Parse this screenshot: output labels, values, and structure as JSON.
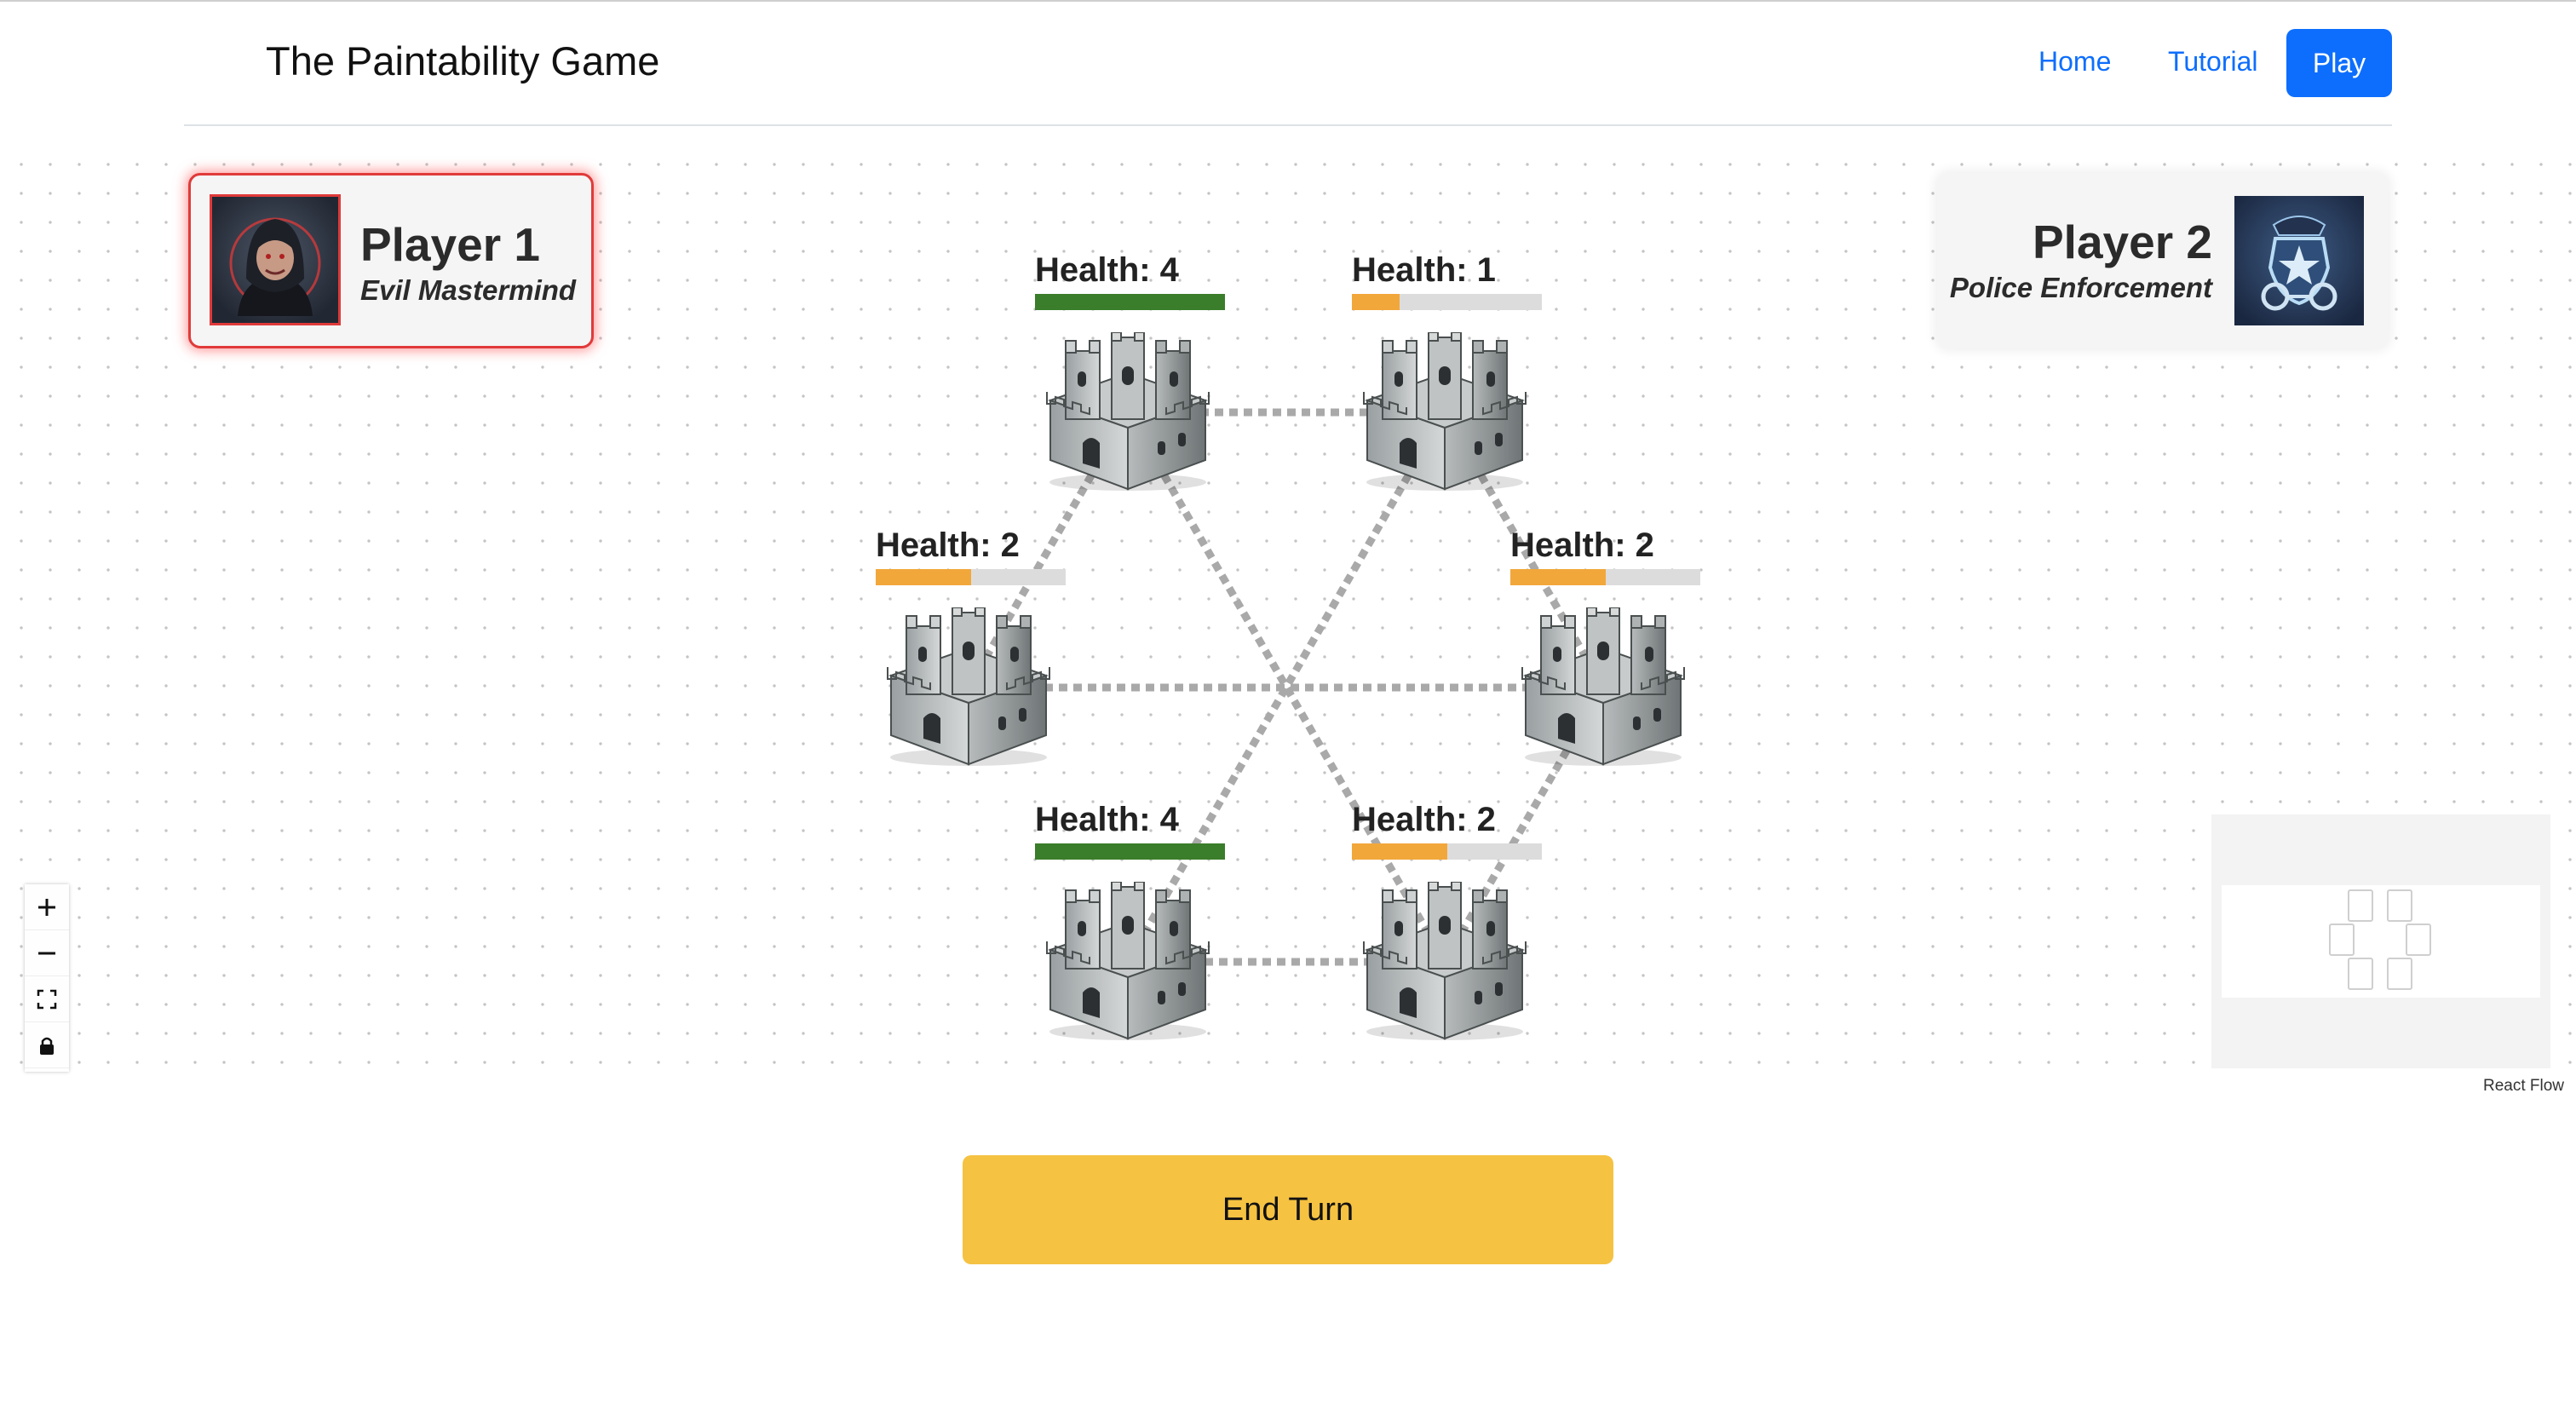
{
  "header": {
    "title": "The Paintability Game",
    "nav": {
      "home": "Home",
      "tutorial": "Tutorial",
      "play": "Play"
    }
  },
  "players": [
    {
      "name": "Player 1",
      "role": "Evil Mastermind",
      "active": true,
      "avatar_icon": "hooded-villain-icon"
    },
    {
      "name": "Player 2",
      "role": "Police Enforcement",
      "active": false,
      "avatar_icon": "police-badge-icon"
    }
  ],
  "castles": [
    {
      "health_label": "Health: 4",
      "health": 4,
      "health_fraction": 1.0
    },
    {
      "health_label": "Health: 1",
      "health": 1,
      "health_fraction": 0.25
    },
    {
      "health_label": "Health: 2",
      "health": 2,
      "health_fraction": 0.5
    },
    {
      "health_label": "Health: 2",
      "health": 2,
      "health_fraction": 0.5
    },
    {
      "health_label": "Health: 4",
      "health": 4,
      "health_fraction": 1.0
    },
    {
      "health_label": "Health: 2",
      "health": 2,
      "health_fraction": 0.5
    }
  ],
  "edges": [
    [
      0,
      1
    ],
    [
      0,
      3
    ],
    [
      0,
      5
    ],
    [
      1,
      2
    ],
    [
      1,
      4
    ],
    [
      2,
      3
    ],
    [
      2,
      5
    ],
    [
      3,
      4
    ]
  ],
  "colors": {
    "health_high": "#3a7d2a",
    "health_low": "#f2a73b",
    "health_track": "#dcdcdc",
    "edge": "#a9a9a9",
    "active_player_border": "#e03a3a",
    "nav_link": "#0d6efd",
    "end_turn": "#f5c242"
  },
  "controls": [
    "zoom-in-icon",
    "zoom-out-icon",
    "fit-view-icon",
    "lock-icon"
  ],
  "attribution": "React Flow",
  "end_turn_label": "End Turn"
}
